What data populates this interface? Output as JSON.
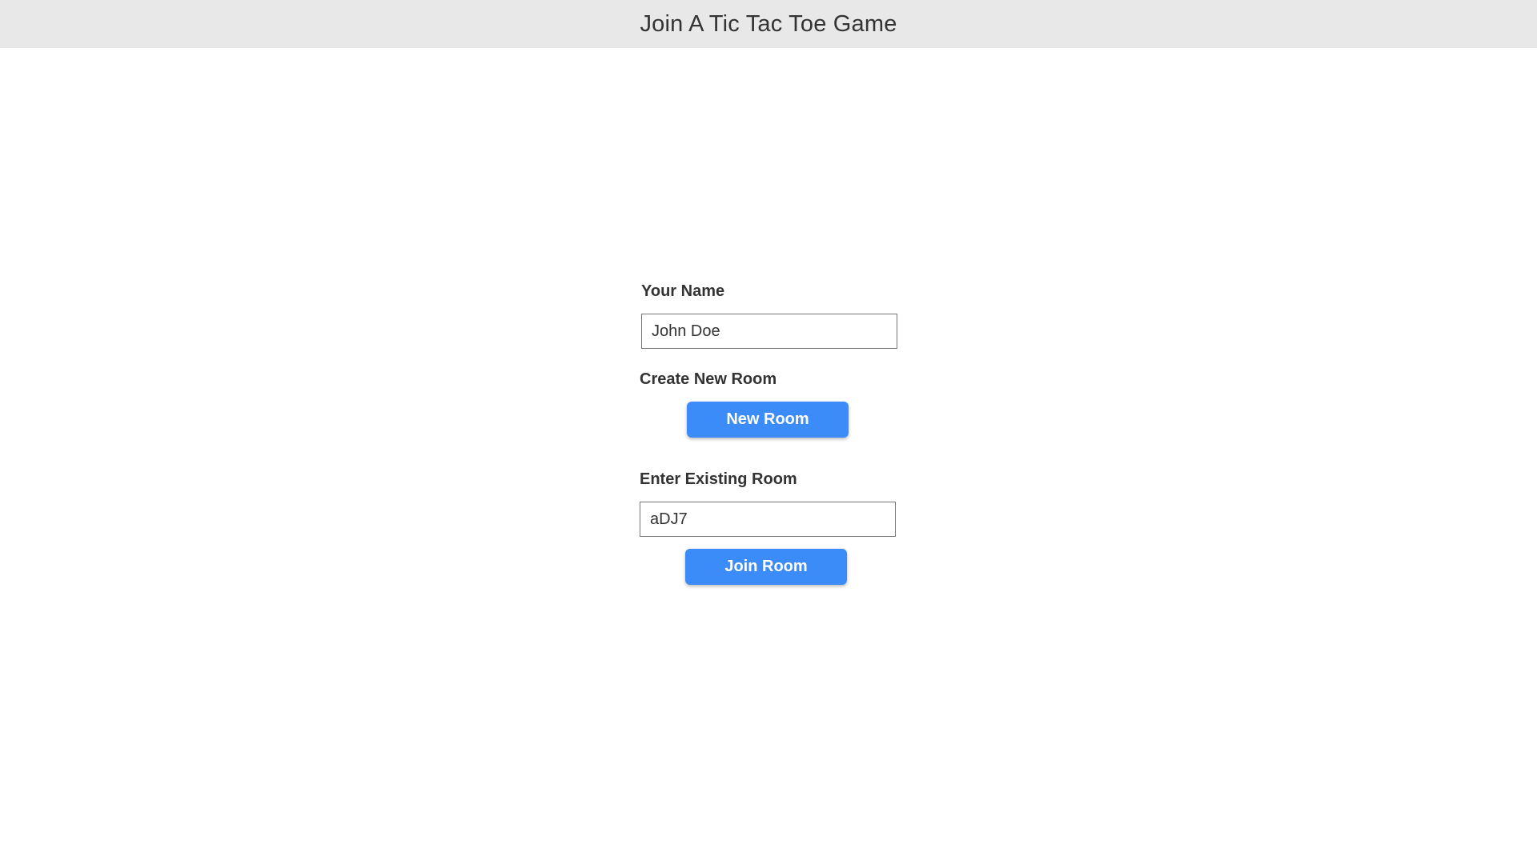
{
  "header": {
    "title": "Join A Tic Tac Toe Game"
  },
  "form": {
    "name_label": "Your Name",
    "name_value": "John Doe",
    "create_label": "Create New Room",
    "new_room_button": "New Room",
    "existing_label": "Enter Existing Room",
    "room_code_value": "aDJ7",
    "join_room_button": "Join Room"
  },
  "colors": {
    "header_bg": "#e8e8e8",
    "button_bg": "#3b8bf8",
    "text": "#333333"
  }
}
